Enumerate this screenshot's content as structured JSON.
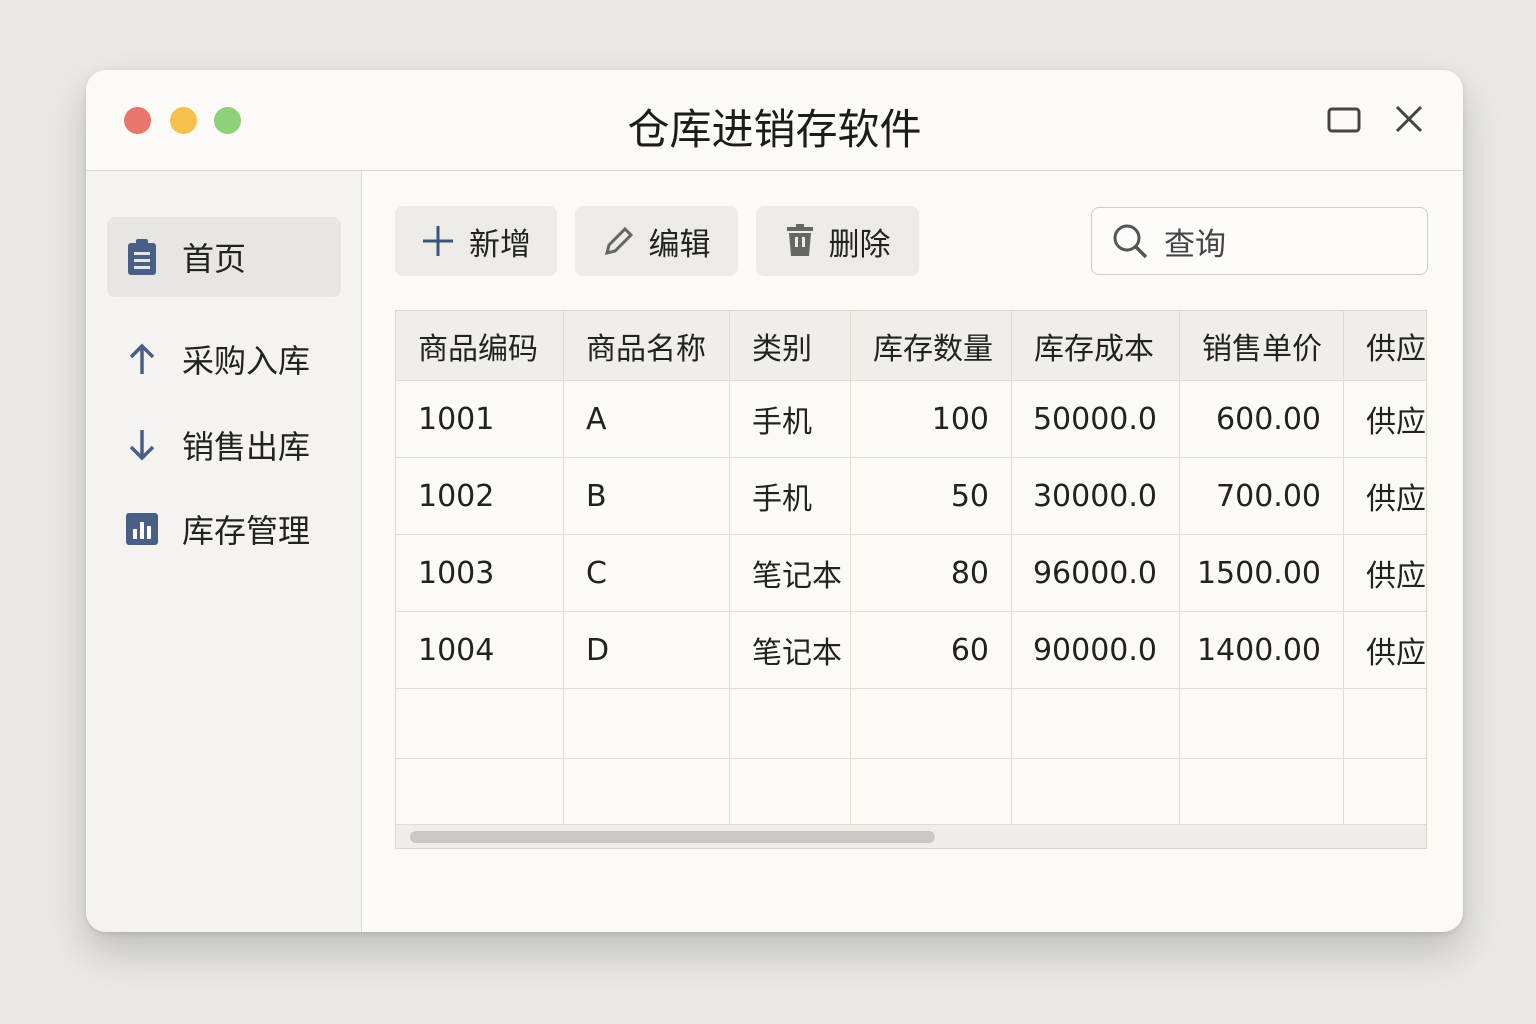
{
  "window": {
    "title": "仓库进销存软件"
  },
  "sidebar": {
    "items": [
      {
        "label": "首页",
        "icon": "clipboard-icon",
        "active": true
      },
      {
        "label": "采购入库",
        "icon": "arrow-up-icon"
      },
      {
        "label": "销售出库",
        "icon": "arrow-down-icon"
      },
      {
        "label": "库存管理",
        "icon": "bar-chart-icon"
      }
    ]
  },
  "toolbar": {
    "add": "新增",
    "edit": "编辑",
    "delete": "删除"
  },
  "search": {
    "placeholder": "查询"
  },
  "table": {
    "headers": [
      "商品编码",
      "商品名称",
      "类别",
      "库存数量",
      "库存成本",
      "销售单价",
      "供应"
    ],
    "rows": [
      [
        "1001",
        "A",
        "手机",
        "100",
        "50000.0",
        "600.00",
        "供应"
      ],
      [
        "1002",
        "B",
        "手机",
        "50",
        "30000.0",
        "700.00",
        "供应"
      ],
      [
        "1003",
        "C",
        "笔记本",
        "80",
        "96000.0",
        "1500.00",
        "供应"
      ],
      [
        "1004",
        "D",
        "笔记本",
        "60",
        "90000.0",
        "1400.00",
        "供应"
      ]
    ]
  },
  "colors": {
    "accent": "#4a5f85",
    "close": "#e8766a",
    "minimize": "#f5c04e",
    "maximize": "#8fd07a"
  }
}
